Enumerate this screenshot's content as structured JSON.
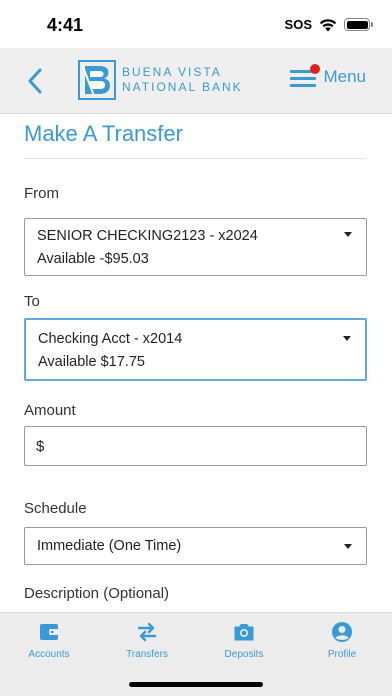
{
  "status": {
    "time": "4:41",
    "sos": "SOS"
  },
  "header": {
    "bank_name_line1": "BUENA VISTA",
    "bank_name_line2": "NATIONAL BANK",
    "menu_label": "Menu",
    "menu_badge_color": "#e02020",
    "accent": "#3a9ad6"
  },
  "form": {
    "title": "Make A Transfer",
    "from": {
      "label": "From",
      "account": "SENIOR CHECKING2123 - x2024",
      "available": "Available  -$95.03"
    },
    "to": {
      "label": "To",
      "account": "Checking Acct - x2014",
      "available": "Available  $17.75"
    },
    "amount": {
      "label": "Amount",
      "prefix": "$",
      "value": ""
    },
    "schedule": {
      "label": "Schedule",
      "value": "Immediate (One Time)"
    },
    "description": {
      "label": "Description (Optional)"
    }
  },
  "tabs": [
    {
      "label": "Accounts",
      "icon": "wallet-icon"
    },
    {
      "label": "Transfers",
      "icon": "transfer-arrows-icon"
    },
    {
      "label": "Deposits",
      "icon": "camera-icon"
    },
    {
      "label": "Profile",
      "icon": "user-icon"
    }
  ]
}
